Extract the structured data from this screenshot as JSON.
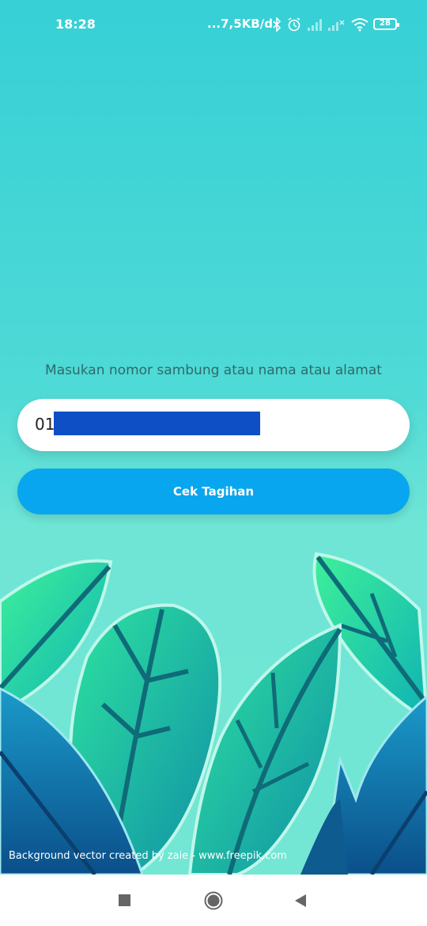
{
  "status_bar": {
    "time": "18:28",
    "network_speed": "...7,5KB/d",
    "battery_level": "28",
    "icons": [
      "bluetooth-icon",
      "alarm-icon",
      "signal-icon",
      "signal-icon",
      "wifi-icon",
      "battery-icon"
    ]
  },
  "form": {
    "prompt": "Masukan nomor sambung atau nama atau alamat",
    "input_value": "01",
    "submit_label": "Cek Tagihan"
  },
  "footer": {
    "credit": "Background vector created by zaie - www.freepik.com"
  },
  "navigation": {
    "icons": [
      "recents-icon",
      "home-icon",
      "back-icon"
    ]
  },
  "colors": {
    "background_top": "#36d0d6",
    "background_bottom": "#73e6d4",
    "button": "#08a6ee",
    "redaction": "#0f4fc6"
  }
}
